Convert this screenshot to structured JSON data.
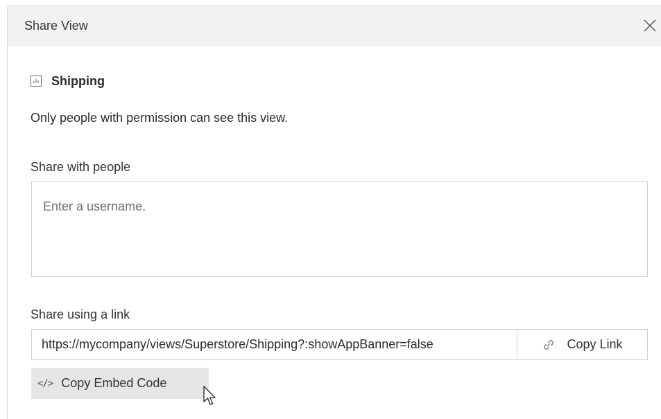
{
  "dialog": {
    "title": "Share View",
    "close_icon": "close-icon"
  },
  "view": {
    "icon": "sheet-icon",
    "name": "Shipping",
    "permission_text": "Only people with permission can see this view."
  },
  "share_people": {
    "label": "Share with people",
    "placeholder": "Enter a username.",
    "value": ""
  },
  "share_link": {
    "label": "Share using a link",
    "url": "https://mycompany/views/Superstore/Shipping?:showAppBanner=false",
    "copy_link_label": "Copy Link",
    "copy_link_icon": "link-icon"
  },
  "embed": {
    "label": "Copy Embed Code",
    "icon": "code-icon",
    "icon_glyph": "</>"
  }
}
